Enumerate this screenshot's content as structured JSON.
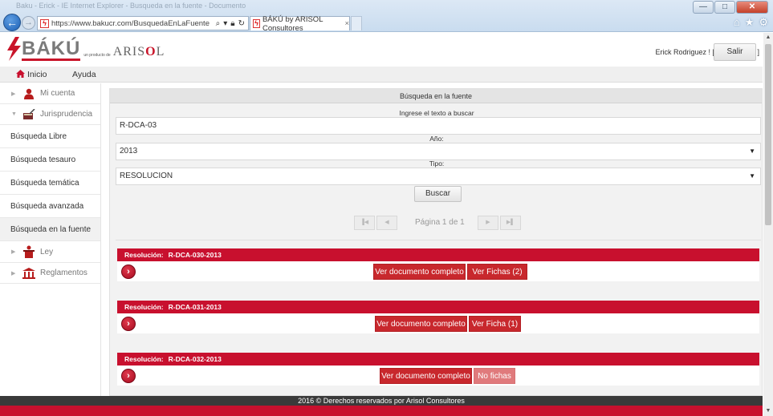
{
  "browser": {
    "titlebar_text": "Baku - Erick - IE Internet Explorer - Busqueda en la fuente - Documento",
    "url": "https://www.bakucr.com/BusquedaEnLaFuente",
    "tab_title": "BÁKÚ by ARISOL Consultores",
    "tab_close": "×",
    "win_min": "—",
    "win_max": "□",
    "win_close": "✕",
    "icons": [
      "home-icon",
      "star-icon",
      "gear-icon"
    ]
  },
  "header": {
    "logo_text": "BÁKÚ",
    "logo_sub": "un producto de",
    "logo_brand_a": "ARIS",
    "logo_brand_b": "O",
    "logo_brand_c": "L",
    "user_label": "Erick Rodriguez ! [",
    "user_close": "]",
    "logout_label": "Salir"
  },
  "menu": {
    "home": "Inicio",
    "help": "Ayuda"
  },
  "sidebar": {
    "tree": [
      {
        "label": "Mi cuenta",
        "icon": "user-icon",
        "caret": "▶"
      },
      {
        "label": "Jurisprudencia",
        "icon": "book-icon",
        "caret": "▼"
      }
    ],
    "links": [
      {
        "label": "Búsqueda Libre",
        "active": false
      },
      {
        "label": "Búsqueda tesauro",
        "active": false
      },
      {
        "label": "Búsqueda temática",
        "active": false
      },
      {
        "label": "Búsqueda avanzada",
        "active": false
      },
      {
        "label": "Búsqueda en la fuente",
        "active": true
      }
    ],
    "tree_bottom": [
      {
        "label": "Ley",
        "icon": "podium-icon",
        "caret": "▶"
      },
      {
        "label": "Reglamentos",
        "icon": "building-icon",
        "caret": "▶"
      }
    ]
  },
  "search": {
    "panel_title": "Búsqueda en la fuente",
    "text_label": "Ingrese el texto a buscar",
    "text_value": "R-DCA-03",
    "year_label": "Año:",
    "year_value": "2013",
    "type_label": "Tipo:",
    "type_value": "RESOLUCION",
    "search_button": "Buscar"
  },
  "pager": {
    "first": "▐◀",
    "prev": "◀",
    "text": "Página 1 de 1",
    "next": "▶",
    "last": "▶▌"
  },
  "results": [
    {
      "label": "Resolución:",
      "code": "R-DCA-030-2013",
      "doc_button": "Ver documento completo",
      "fichas_button": "Ver Fichas (2)",
      "fichas_enabled": true
    },
    {
      "label": "Resolución:",
      "code": "R-DCA-031-2013",
      "doc_button": "Ver documento completo",
      "fichas_button": "Ver Ficha (1)",
      "fichas_enabled": true
    },
    {
      "label": "Resolución:",
      "code": "R-DCA-032-2013",
      "doc_button": "Ver documento completo",
      "fichas_button": "No fichas",
      "fichas_enabled": false
    }
  ],
  "footer": {
    "text": "2016 © Derechos reservados por Arisol Consultores"
  },
  "colors": {
    "brand_red": "#c8102e",
    "button_red": "#c8282d",
    "button_disabled": "#e07a7c",
    "footer_dark": "#3a3a3a"
  }
}
